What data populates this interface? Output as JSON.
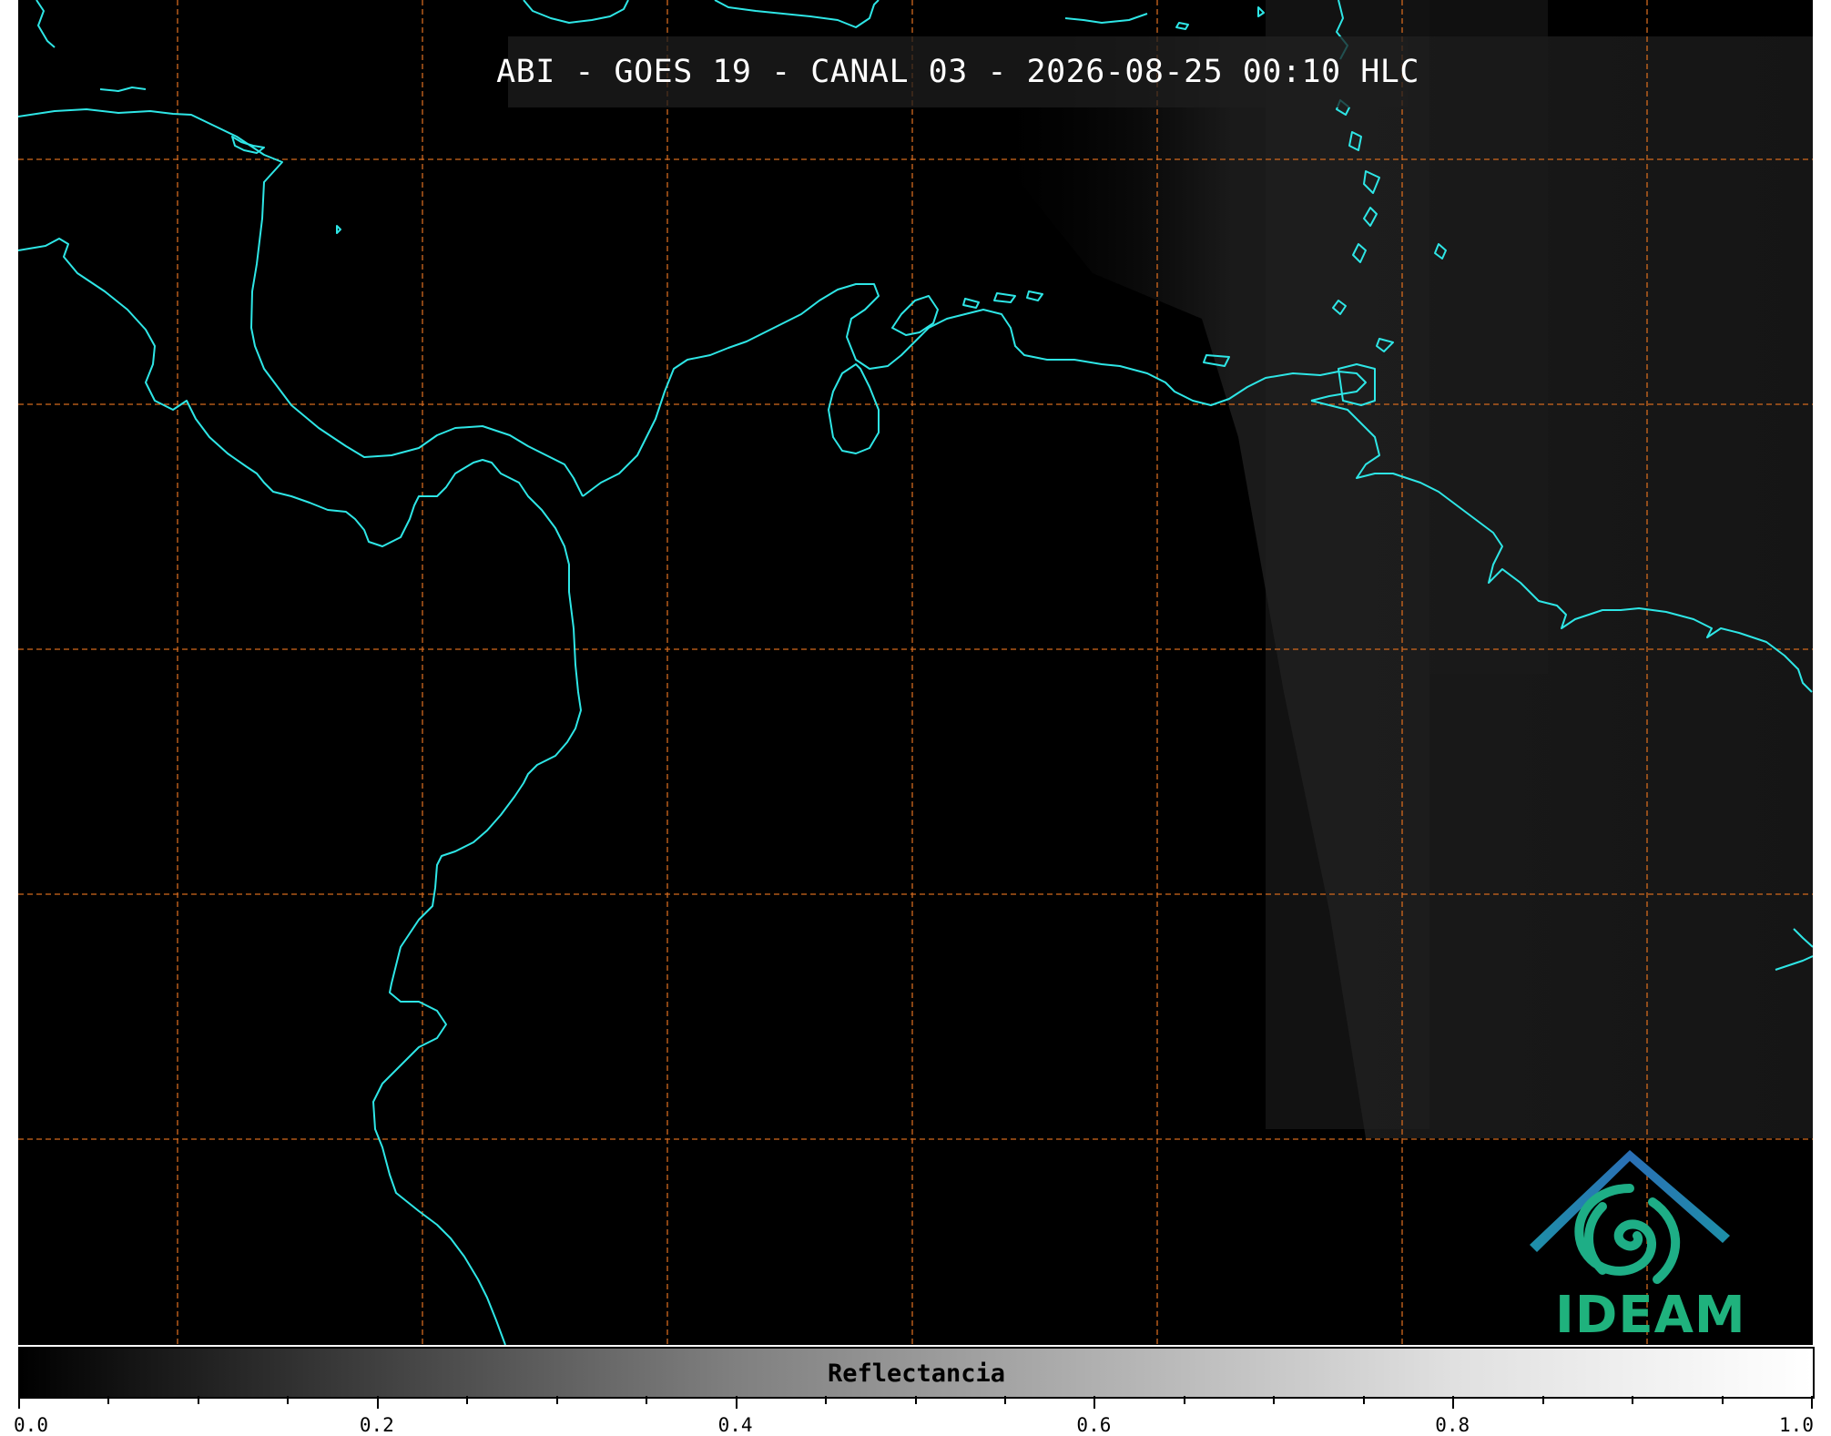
{
  "title": "ABI - GOES 19 - CANAL 03 - 2026-08-25 00:10 HLC",
  "colorbar": {
    "label": "Reflectancia",
    "ticks": [
      "0.0",
      "0.2",
      "0.4",
      "0.6",
      "0.8",
      "1.0"
    ],
    "range": [
      0.0,
      1.0
    ]
  },
  "logo": {
    "text": "IDEAM"
  },
  "colors": {
    "coastline": "#2ee6e6",
    "gridline": "#d2691e",
    "background": "#000000"
  }
}
